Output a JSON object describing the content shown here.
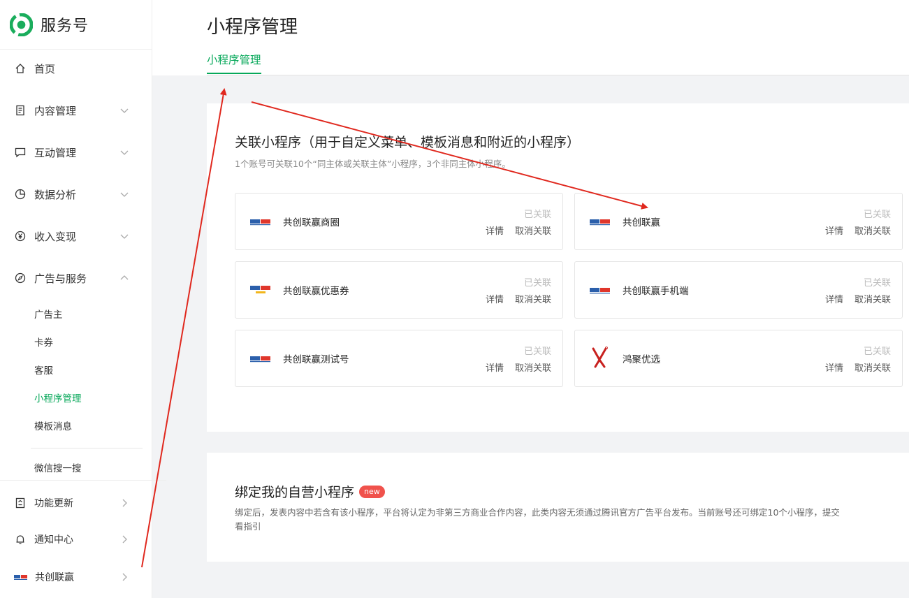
{
  "app": {
    "name": "服务号"
  },
  "sidebar": {
    "items": [
      {
        "label": "首页",
        "icon": "home-icon"
      },
      {
        "label": "内容管理",
        "icon": "document-icon"
      },
      {
        "label": "互动管理",
        "icon": "chat-icon"
      },
      {
        "label": "数据分析",
        "icon": "pie-chart-icon"
      },
      {
        "label": "收入变现",
        "icon": "yen-icon"
      },
      {
        "label": "广告与服务",
        "icon": "compass-icon"
      }
    ],
    "sub_items": [
      "广告主",
      "卡券",
      "客服",
      "小程序管理",
      "模板消息",
      "微信搜一搜"
    ],
    "bottom_items": [
      {
        "label": "功能更新",
        "icon": "update-icon"
      },
      {
        "label": "通知中心",
        "icon": "bell-icon"
      },
      {
        "label": "共创联赢",
        "icon": "brand-logo"
      }
    ]
  },
  "header": {
    "title": "小程序管理",
    "tab": "小程序管理"
  },
  "linked_section": {
    "title": "关联小程序（用于自定义菜单、模板消息和附近的小程序）",
    "subtitle": "1个账号可关联10个“同主体或关联主体”小程序，3个非同主体小程序。",
    "status_label": "已关联",
    "detail_label": "详情",
    "unlink_label": "取消关联",
    "programs": [
      {
        "name": "共创联赢商圈"
      },
      {
        "name": "共创联赢"
      },
      {
        "name": "共创联赢优惠券"
      },
      {
        "name": "共创联赢手机端"
      },
      {
        "name": "共创联赢测试号"
      },
      {
        "name": "鸿聚优选"
      }
    ]
  },
  "bind_section": {
    "title": "绑定我的自营小程序",
    "badge": "new",
    "description_line1": "绑定后，发表内容中若含有该小程序，平台将认定为非第三方商业合作内容，此类内容无须通过腾讯官方广告平台发布。当前账号还可绑定10个小程序，提交",
    "description_line2": "看指引"
  },
  "colors": {
    "accent": "#07a85a",
    "badge": "#f0524c",
    "annotation_arrow": "#e0281e"
  }
}
